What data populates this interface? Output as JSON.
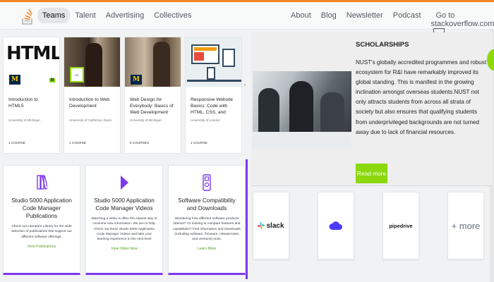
{
  "header": {
    "nav_left": [
      "Teams",
      "Talent",
      "Advertising",
      "Collectives"
    ],
    "nav_right": [
      "About",
      "Blog",
      "Newsletter",
      "Podcast",
      "Go to stackoverflow.com"
    ]
  },
  "courses": [
    {
      "title": "Introduction to HTML5",
      "university": "University of Michigan",
      "count": "1 COURSE",
      "thumb_text": "HTML"
    },
    {
      "title": "Introduction to Web Development",
      "university": "University of California, Davis",
      "count": "1 COURSE"
    },
    {
      "title": "Web Design for Everybody: Basics of Web Development &...",
      "university": "University of Michigan",
      "count": "5 COURSES"
    },
    {
      "title": "Responsive Website Basics: Code with HTML, CSS, and JavaS...",
      "university": "University of London",
      "count": "1 COURSE"
    }
  ],
  "cards": [
    {
      "title": "Studio 5000 Application Code Manager Publications",
      "desc": "Check out Literature Library for the wide selection of publications that support our different software offerings.",
      "link": "View Publications"
    },
    {
      "title": "Studio 5000 Application Code Manager Videos",
      "desc": "Watching a video is often the easiest way to consume new information. We are to help. Check out these Studio 5000 Application Code Manager Videos and take your learning experience to the next level",
      "link": "View Video Now"
    },
    {
      "title": "Software Compatibility and Downloads",
      "desc": "Wondering how different software products interact? Or looking to compare features and capabilities? Find information and downloads (including software, firmware, releasenotes and versions) tools.",
      "link": "Learn More"
    }
  ],
  "scholarship": {
    "heading": "SCHOLARSHIPS",
    "body": "NUST's globally accredited programmes and robust ecosystem for R&I have remarkably improved its global standing. This is manifest in the growing inclination amongst overseas students.NUST not only attracts students from across all strata of society but also ensures that qualifying students from underprivileged backgrounds are not turned away due to lack of financial resources.",
    "button": "Read more"
  },
  "logos": [
    "slack",
    "",
    "pipedrive",
    "+ more"
  ],
  "colors": {
    "accent": "#7c3aed",
    "green": "#8bd80b",
    "brand": "#f48225"
  }
}
